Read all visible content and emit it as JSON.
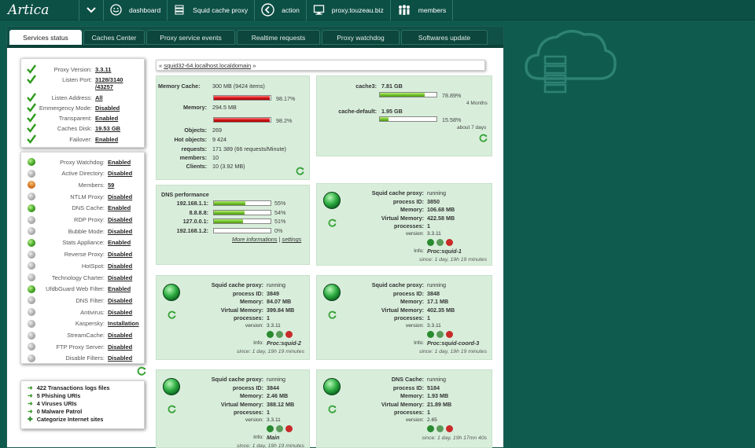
{
  "topbar": {
    "logo": "Artica",
    "items": [
      {
        "icon": "dashboard-icon",
        "label": "dashboard"
      },
      {
        "icon": "server-icon",
        "label": "Squid cache proxy"
      },
      {
        "icon": "back-icon",
        "label": "action"
      },
      {
        "icon": "monitor-icon",
        "label": "proxy.touzeau.biz"
      },
      {
        "icon": "members-icon",
        "label": "members"
      }
    ]
  },
  "tabs": [
    "Services status",
    "Caches Center",
    "Proxy service events",
    "Realtime requests",
    "Proxy watchdog",
    "Softwares update"
  ],
  "breadcrumb": {
    "prefix": "«",
    "host": "squid32-64.localhost.localdomain",
    "suffix": "»"
  },
  "proxy_info": [
    {
      "label": "Proxy Version:",
      "value": "3.3.11"
    },
    {
      "label": "Listen Port:",
      "value": "3128/3140"
    },
    {
      "label": "",
      "value": "/43257"
    },
    {
      "label": "Listen Address:",
      "value": "All"
    },
    {
      "label": "Emmergency Mode:",
      "value": "Disabled"
    },
    {
      "label": "Transparent:",
      "value": "Enabled"
    },
    {
      "label": "Caches Disk:",
      "value": "19.53 GB"
    },
    {
      "label": "Failover:",
      "value": "Enabled"
    }
  ],
  "features": [
    {
      "label": "Proxy Watchdog:",
      "value": "Enabled",
      "status": "on"
    },
    {
      "label": "Active Directory:",
      "value": "Disabled",
      "status": "off"
    },
    {
      "label": "Members:",
      "value": "59",
      "status": "members"
    },
    {
      "label": "NTLM Proxy:",
      "value": "Disabled",
      "status": "off"
    },
    {
      "label": "DNS Cache:",
      "value": "Enabled",
      "status": "on"
    },
    {
      "label": "RDP Proxy:",
      "value": "Disabled",
      "status": "off"
    },
    {
      "label": "Bubble Mode:",
      "value": "Disabled",
      "status": "off"
    },
    {
      "label": "Stats Appliance:",
      "value": "Enabled",
      "status": "on"
    },
    {
      "label": "Reverse Proxy:",
      "value": "Disabled",
      "status": "off"
    },
    {
      "label": "HotSpot:",
      "value": "Disabled",
      "status": "off"
    },
    {
      "label": "Technology Charter:",
      "value": "Disabled",
      "status": "off"
    },
    {
      "label": "UfdbGuard Web Filter:",
      "value": "Enabled",
      "status": "on"
    },
    {
      "label": "DNS Filter:",
      "value": "Disabled",
      "status": "off"
    },
    {
      "label": "Antivirus:",
      "value": "Disabled",
      "status": "off"
    },
    {
      "label": "Kaspersky:",
      "value": "Installation",
      "status": "off"
    },
    {
      "label": "StreamCache:",
      "value": "Disabled",
      "status": "off"
    },
    {
      "label": "FTP Proxy Server:",
      "value": "Disabled",
      "status": "off"
    },
    {
      "label": "Disable Filters:",
      "value": "Disabled",
      "status": "off"
    }
  ],
  "stats_list": [
    "422 Transactions logs files",
    "5 Phishing URIs",
    "4 Viruses URIs",
    "0 Malware Patrol",
    "Categorize Internet sites"
  ],
  "memory_card": {
    "rows": [
      {
        "label": "Memory Cache:",
        "value": "300 MB (9424 items)"
      },
      {
        "label": "Memory:",
        "value": "294.5 MB"
      },
      {
        "label": "Objects:",
        "value": "269"
      },
      {
        "label": "Hot objects:",
        "value": "9 424"
      },
      {
        "label": "requests:",
        "value": "171 389 (66 requests/Minute)"
      },
      {
        "label": "members:",
        "value": "10"
      },
      {
        "label": "Clients:",
        "value": "10 (3.92 MB)"
      }
    ],
    "bars": [
      {
        "percent": 98.17,
        "label": "98.17%"
      },
      {
        "percent": 98.2,
        "label": "98.2%"
      }
    ]
  },
  "cache_card": {
    "items": [
      {
        "label": "cache3:",
        "size": "7.81 GB",
        "percent": 78.89,
        "pct_label": "78.89%",
        "note": "4 Months"
      },
      {
        "label": "cache-default:",
        "size": "1.95 GB",
        "percent": 15.58,
        "pct_label": "15.58%",
        "note": "about 7 days"
      }
    ]
  },
  "dns_card": {
    "title": "DNS performance",
    "rows": [
      {
        "ip": "192.168.1.1:",
        "percent": 55,
        "label": "55%"
      },
      {
        "ip": "8.8.8.8:",
        "percent": 54,
        "label": "54%"
      },
      {
        "ip": "127.0.0.1:",
        "percent": 51,
        "label": "51%"
      },
      {
        "ip": "192.168.1.2:",
        "percent": 0,
        "label": "0%"
      }
    ],
    "more_link": "More informations",
    "sep": "|",
    "settings_link": "settings"
  },
  "services": [
    {
      "rows": [
        {
          "label": "Squid cache proxy:",
          "value": "running"
        },
        {
          "label": "process ID:",
          "value": "3850"
        },
        {
          "label": "Memory:",
          "value": "106.68 MB"
        },
        {
          "label": "Virtual Memory:",
          "value": "422.58 MB"
        },
        {
          "label": "processes:",
          "value": "1"
        },
        {
          "label": "version:",
          "value": "3.3.11"
        }
      ],
      "info_label": "Info:",
      "info_value": "Proc:squid-1",
      "since": "since: 1 day, 19h 19 minutes"
    },
    {
      "rows": [
        {
          "label": "Squid cache proxy:",
          "value": "running"
        },
        {
          "label": "process ID:",
          "value": "3849"
        },
        {
          "label": "Memory:",
          "value": "84.07 MB"
        },
        {
          "label": "Virtual Memory:",
          "value": "399.84 MB"
        },
        {
          "label": "processes:",
          "value": "1"
        },
        {
          "label": "version:",
          "value": "3.3.11"
        }
      ],
      "info_label": "Info:",
      "info_value": "Proc:squid-2",
      "since": "since: 1 day, 19h 19 minutes"
    },
    {
      "rows": [
        {
          "label": "Squid cache proxy:",
          "value": "running"
        },
        {
          "label": "process ID:",
          "value": "3848"
        },
        {
          "label": "Memory:",
          "value": "17.1 MB"
        },
        {
          "label": "Virtual Memory:",
          "value": "402.35 MB"
        },
        {
          "label": "processes:",
          "value": "1"
        },
        {
          "label": "version:",
          "value": "3.3.11"
        }
      ],
      "info_label": "Info:",
      "info_value": "Proc:squid-coord-3",
      "since": "since: 1 day, 19h 19 minutes"
    },
    {
      "rows": [
        {
          "label": "Squid cache proxy:",
          "value": "running"
        },
        {
          "label": "process ID:",
          "value": "3844"
        },
        {
          "label": "Memory:",
          "value": "2.46 MB"
        },
        {
          "label": "Virtual Memory:",
          "value": "388.12 MB"
        },
        {
          "label": "processes:",
          "value": "1"
        },
        {
          "label": "version:",
          "value": "3.3.11"
        }
      ],
      "info_label": "Info:",
      "info_value": "Main",
      "since": "since: 1 day, 19h 19 minutes"
    },
    {
      "rows": [
        {
          "label": "DNS Cache:",
          "value": "running"
        },
        {
          "label": "process ID:",
          "value": "5184"
        },
        {
          "label": "Memory:",
          "value": "1.93 MB"
        },
        {
          "label": "Virtual Memory:",
          "value": "21.89 MB"
        },
        {
          "label": "processes:",
          "value": "1"
        },
        {
          "label": "version:",
          "value": "2.65"
        }
      ],
      "since": "since: 1 day, 19h 17mn 40s"
    }
  ]
}
